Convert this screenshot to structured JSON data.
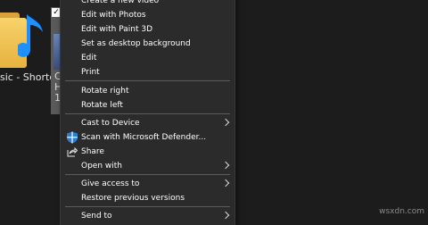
{
  "desktop": {
    "music_label": "sic - Shortcut",
    "selected_label_parts": [
      "C",
      "H",
      "1"
    ]
  },
  "menu": {
    "items": [
      {
        "label": "Create a new video"
      },
      {
        "label": "Edit with Photos"
      },
      {
        "label": "Edit with Paint 3D"
      },
      {
        "label": "Set as desktop background"
      },
      {
        "label": "Edit"
      },
      {
        "label": "Print"
      },
      {
        "label": "Rotate right"
      },
      {
        "label": "Rotate left"
      },
      {
        "label": "Cast to Device"
      },
      {
        "label": "Scan with Microsoft Defender..."
      },
      {
        "label": "Share"
      },
      {
        "label": "Open with"
      },
      {
        "label": "Give access to"
      },
      {
        "label": "Restore previous versions"
      },
      {
        "label": "Send to"
      }
    ]
  },
  "watermark": "wsxdn.com"
}
